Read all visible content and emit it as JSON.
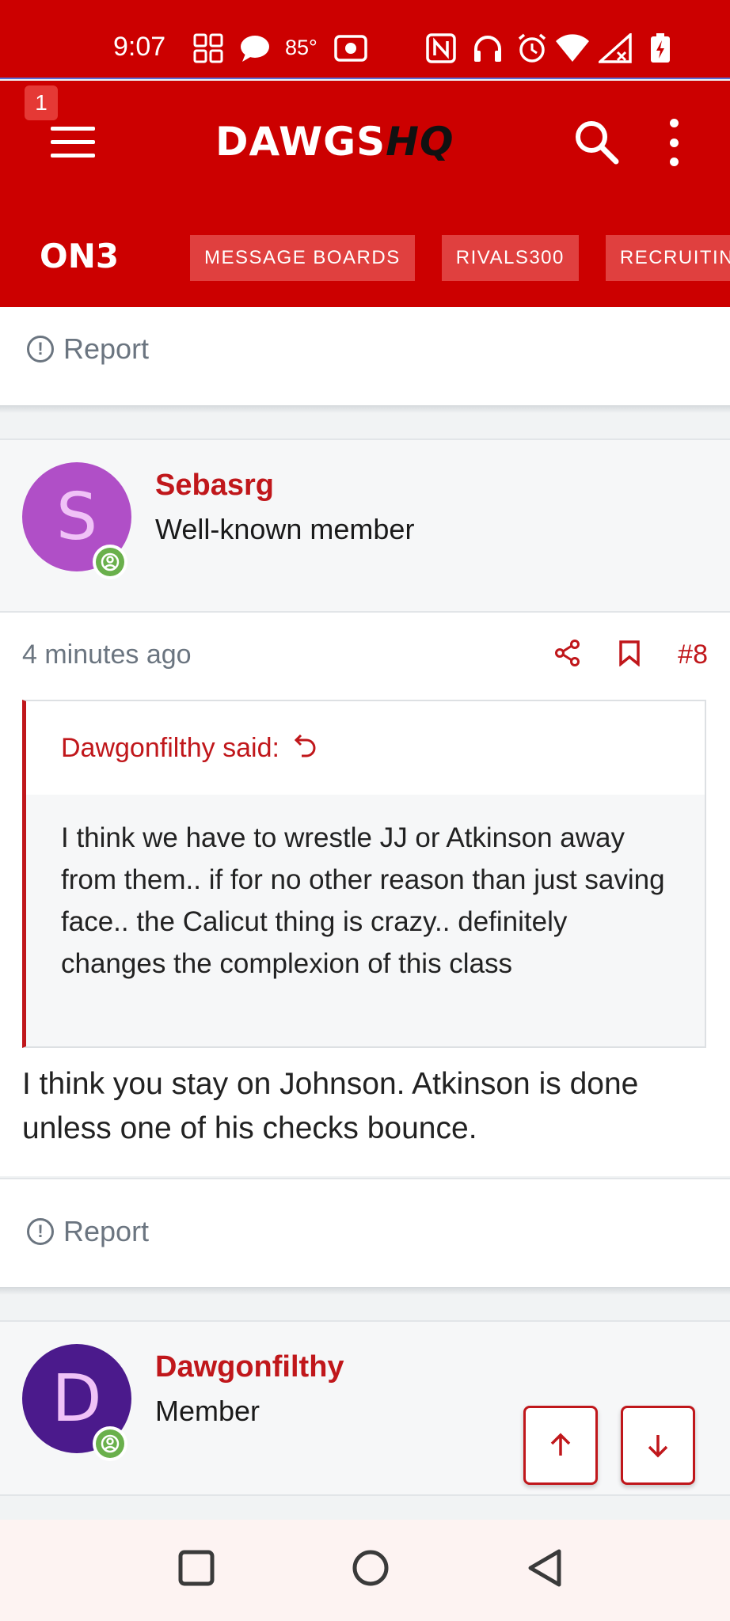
{
  "status_bar": {
    "time": "9:07",
    "temperature": "85°",
    "icons": [
      "grid-icon",
      "chat-bubble-icon",
      "camera-icon",
      "nfc-icon",
      "headphones-icon",
      "alarm-icon",
      "wifi-icon",
      "signal-icon",
      "battery-charging-icon"
    ]
  },
  "header": {
    "notification_count": "1",
    "logo_part1": "DAWGS",
    "logo_part2": "HQ",
    "brand": "ON3",
    "nav": [
      "MESSAGE BOARDS",
      "RIVALS300",
      "RECRUITING"
    ]
  },
  "report_label": "Report",
  "post8": {
    "username": "Sebasrg",
    "avatar_letter": "S",
    "avatar_color": "#b04fc7",
    "user_title": "Well-known member",
    "time_ago": "4 minutes ago",
    "post_number": "#8",
    "quote_author": "Dawgonfilthy said:",
    "quote_text": "I think we have to wrestle JJ or Atkinson away from them.. if for no other reason than just saving face.. the Calicut thing is crazy.. definitely changes the complexion of this class",
    "body": "I think you stay on Johnson. Atkinson is done unless one of his checks bounce."
  },
  "post9": {
    "username": "Dawgonfilthy",
    "avatar_letter": "D",
    "avatar_color": "#4b1a8c",
    "user_title": "Member"
  },
  "colors": {
    "brand_red": "#cc0000",
    "link_red": "#c0171b",
    "online_green": "#6ab04c"
  }
}
